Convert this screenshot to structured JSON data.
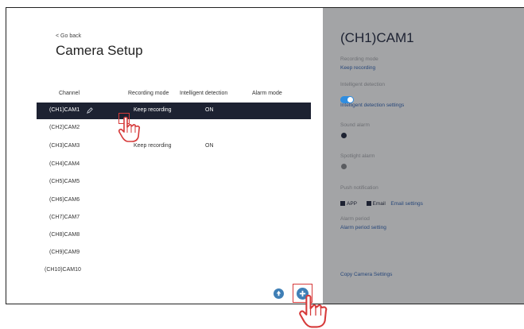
{
  "header": {
    "go_back": "< Go back",
    "title": "Camera Setup"
  },
  "table": {
    "columns": [
      "Channel",
      "Recording mode",
      "Intelligent detection",
      "Alarm mode"
    ],
    "rows": [
      {
        "channel": "(CH1)CAM1",
        "recording_mode": "Keep recording",
        "intelligent_detection": "ON"
      },
      {
        "channel": "(CH2)CAM2",
        "recording_mode": "",
        "intelligent_detection": ""
      },
      {
        "channel": "(CH3)CAM3",
        "recording_mode": "Keep recording",
        "intelligent_detection": "ON"
      },
      {
        "channel": "(CH4)CAM4",
        "recording_mode": "",
        "intelligent_detection": ""
      },
      {
        "channel": "(CH5)CAM5",
        "recording_mode": "",
        "intelligent_detection": ""
      },
      {
        "channel": "(CH6)CAM6",
        "recording_mode": "",
        "intelligent_detection": ""
      },
      {
        "channel": "(CH7)CAM7",
        "recording_mode": "",
        "intelligent_detection": ""
      },
      {
        "channel": "(CH8)CAM8",
        "recording_mode": "",
        "intelligent_detection": ""
      },
      {
        "channel": "(CH9)CAM9",
        "recording_mode": "",
        "intelligent_detection": ""
      },
      {
        "channel": "(CH10)CAM10",
        "recording_mode": "",
        "intelligent_detection": ""
      }
    ]
  },
  "panel": {
    "title": "(CH1)CAM1",
    "recording_mode_label": "Recording mode",
    "recording_mode_value": "Keep recording",
    "intelligent_detection_label": "Intelligent detection",
    "intelligent_detection_on": true,
    "intelligent_detection_settings": "Intelligent detection settings",
    "sound_alarm_label": "Sound alarm",
    "spotlight_alarm_label": "Spotlight alarm",
    "push_label": "Push notification",
    "push_app": "APP",
    "push_email": "Email",
    "email_settings": "Email settings",
    "alarm_period_label": "Alarm period",
    "alarm_period_setting": "Alarm period setting",
    "copy_settings": "Copy Camera Settings"
  },
  "colors": {
    "selected_row": "#1d2232",
    "panel_bg": "#a3a4a6",
    "accent_blue": "#2f8de0",
    "link": "#27477a",
    "highlight_red": "#d63a3a"
  }
}
